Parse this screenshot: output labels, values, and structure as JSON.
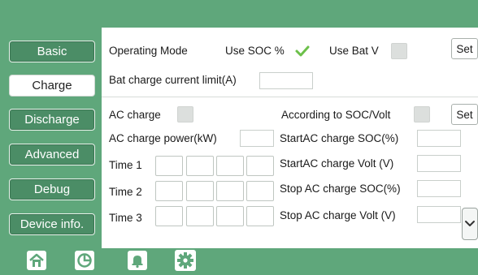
{
  "sidebar": {
    "items": [
      {
        "label": "Basic"
      },
      {
        "label": "Charge"
      },
      {
        "label": "Discharge"
      },
      {
        "label": "Advanced"
      },
      {
        "label": "Debug"
      },
      {
        "label": "Device info."
      }
    ]
  },
  "charge": {
    "operating_mode_label": "Operating Mode",
    "use_soc_label": "Use SOC %",
    "use_bat_v_label": "Use Bat V",
    "set_label": "Set",
    "bat_charge_limit_label": "Bat charge current limit(A)",
    "bat_charge_limit_value": "",
    "ac_charge_label": "AC charge",
    "according_label": "According to SOC/Volt",
    "ac_charge_power_label": "AC charge power(kW)",
    "ac_charge_power_value": "",
    "start_soc_label": "StartAC charge SOC(%)",
    "start_soc_value": "",
    "start_volt_label": "StartAC charge Volt (V)",
    "start_volt_value": "",
    "stop_soc_label": "Stop AC charge SOC(%)",
    "stop_soc_value": "",
    "stop_volt_label": "Stop AC charge Volt (V)",
    "stop_volt_value": "",
    "time_rows": [
      {
        "label": "Time  1"
      },
      {
        "label": "Time  2"
      },
      {
        "label": "Time  3"
      }
    ]
  },
  "colors": {
    "header_green": "#5fa77b",
    "nav_button": "#4b8d66",
    "check_green": "#6cc04a"
  },
  "icons": [
    "home-icon",
    "pie-chart-icon",
    "bell-icon",
    "gear-icon",
    "chevron-down-icon",
    "checkmark-icon"
  ]
}
